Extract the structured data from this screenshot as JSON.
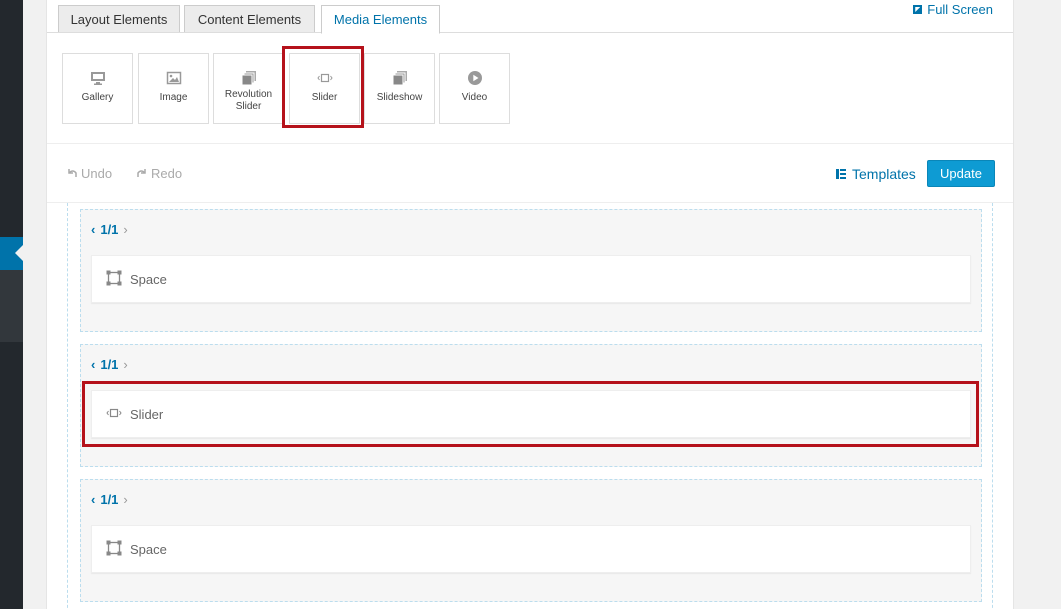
{
  "tabs": [
    {
      "label": "Layout Elements"
    },
    {
      "label": "Content Elements"
    },
    {
      "label": "Media Elements"
    }
  ],
  "fullscreen_label": "Full Screen",
  "media_tiles": [
    {
      "label": "Gallery",
      "icon": "monitor-icon"
    },
    {
      "label": "Image",
      "icon": "image-icon"
    },
    {
      "label": "Revolution Slider",
      "icon": "stack-icon"
    },
    {
      "label": "Slider",
      "icon": "slider-icon"
    },
    {
      "label": "Slideshow",
      "icon": "stack-icon"
    },
    {
      "label": "Video",
      "icon": "play-icon"
    }
  ],
  "toolbar": {
    "undo_label": "Undo",
    "redo_label": "Redo",
    "templates_label": "Templates",
    "update_label": "Update"
  },
  "rows": [
    {
      "fraction": "1/1",
      "element_label": "Space",
      "element_icon": "space-icon"
    },
    {
      "fraction": "1/1",
      "element_label": "Slider",
      "element_icon": "slider-icon"
    },
    {
      "fraction": "1/1",
      "element_label": "Space",
      "element_icon": "space-icon"
    }
  ],
  "colors": {
    "accent": "#0073aa",
    "update_button": "#0e9bd3",
    "highlight": "#b5121b",
    "admin_bar": "#23282d"
  }
}
